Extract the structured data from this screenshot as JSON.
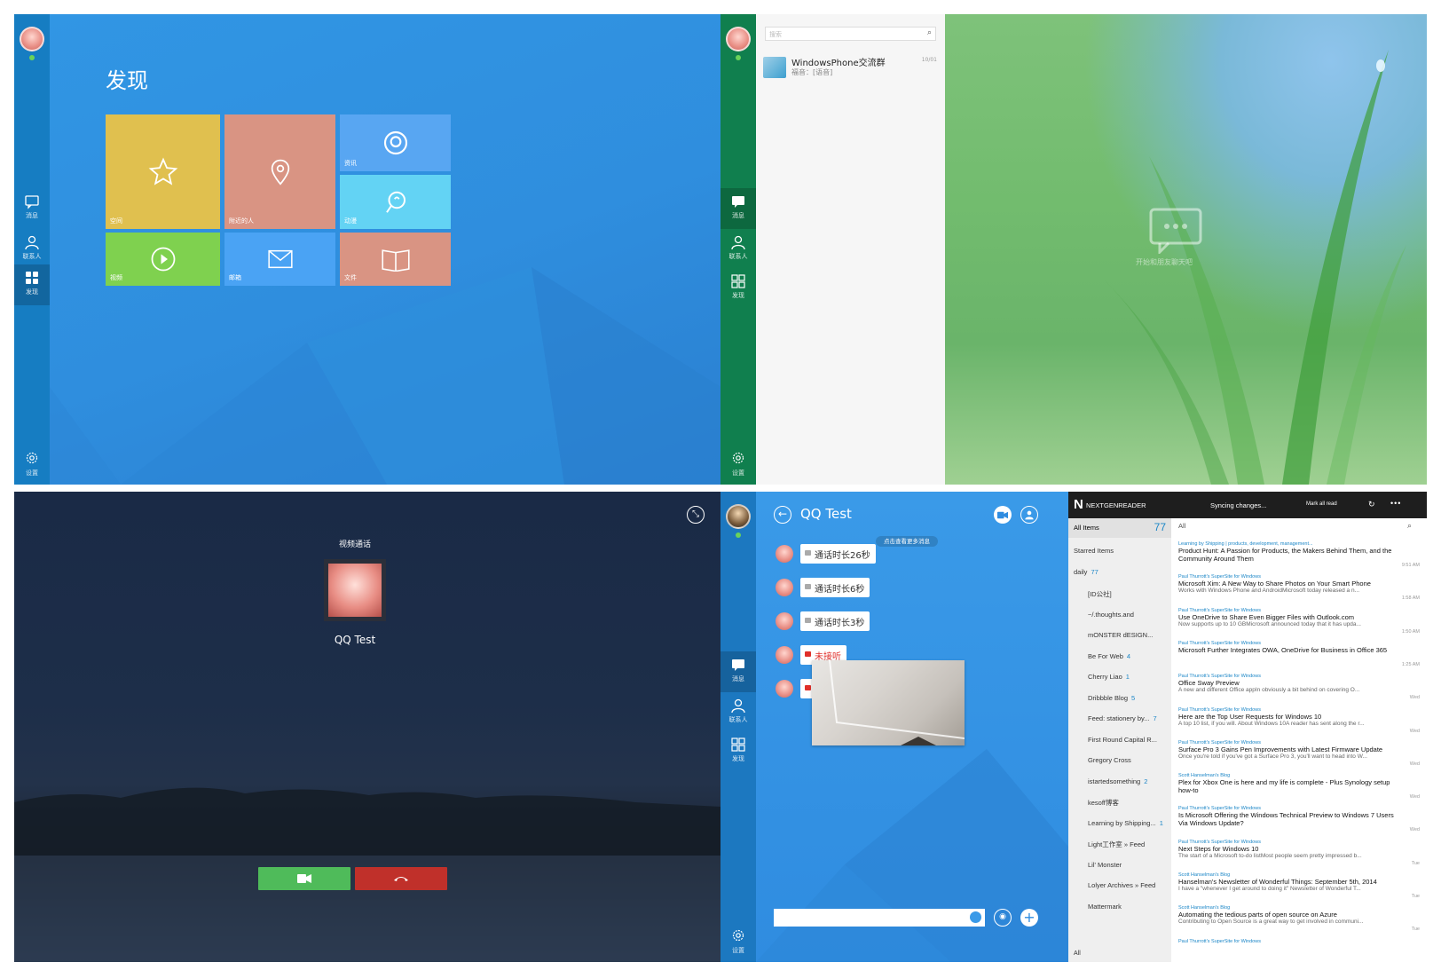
{
  "discover": {
    "title": "发现",
    "tiles": [
      {
        "label": "空间",
        "icon": "star-icon",
        "color": "#e0c04f"
      },
      {
        "label": "附近的人",
        "icon": "location-pin-icon",
        "color": "#d99483"
      },
      {
        "label": "资讯",
        "icon": "qq-logo-icon",
        "color": "#58a6f2"
      },
      {
        "label": "动漫",
        "icon": "comic-icon",
        "color": "#63d3f4"
      },
      {
        "label": "视频",
        "icon": "play-icon",
        "color": "#7fd14f"
      },
      {
        "label": "邮箱",
        "icon": "mail-icon",
        "color": "#4aa3f4"
      },
      {
        "label": "文件",
        "icon": "book-icon",
        "color": "#d99483"
      }
    ],
    "nav": [
      "消息",
      "联系人",
      "发现"
    ],
    "settings_label": "设置"
  },
  "messages": {
    "search_placeholder": "搜索",
    "conversation": {
      "name": "WindowsPhone交流群",
      "snippet": "福音：[语音]",
      "time": "10/01"
    },
    "nav": [
      "消息",
      "联系人",
      "发现"
    ],
    "settings_label": "设置",
    "empty_text": "开始和朋友聊天吧"
  },
  "video_call": {
    "status": "视频通话",
    "name": "QQ Test",
    "accent_accept": "#4fbb5a",
    "accent_decline": "#c0302a"
  },
  "chat": {
    "title": "QQ Test",
    "load_more": "点击查看更多消息",
    "messages": [
      {
        "text": "通话时长26秒",
        "missed": false
      },
      {
        "text": "通话时长6秒",
        "missed": false
      },
      {
        "text": "通话时长3秒",
        "missed": false
      },
      {
        "text": "未接听",
        "missed": true
      },
      {
        "text": "",
        "missed": false
      }
    ],
    "nav": [
      "消息",
      "联系人",
      "发现"
    ],
    "settings_label": "设置"
  },
  "reader": {
    "logo": "NEXTGENREADER",
    "sync": "Syncing changes...",
    "mark_all": "Mark all read",
    "all_items": "All Items",
    "all_count": "77",
    "starred": "Starred Items",
    "filter": "All",
    "folder": "daily",
    "folder_count": "77",
    "feeds": [
      {
        "name": "[ID公社]",
        "count": ""
      },
      {
        "name": "~/.thoughts.and",
        "count": ""
      },
      {
        "name": "mONSTER dESIGN...",
        "count": ""
      },
      {
        "name": "Be For Web",
        "count": "4"
      },
      {
        "name": "Cherry Liao",
        "count": "1"
      },
      {
        "name": "Dribbble Blog",
        "count": "5"
      },
      {
        "name": "Feed: stationery by...",
        "count": "7"
      },
      {
        "name": "First Round Capital R...",
        "count": ""
      },
      {
        "name": "Gregory Cross",
        "count": ""
      },
      {
        "name": "istartedsomething",
        "count": "2"
      },
      {
        "name": "kesoff博客",
        "count": ""
      },
      {
        "name": "Learning by Shipping...",
        "count": "1"
      },
      {
        "name": "Light工作室 » Feed",
        "count": ""
      },
      {
        "name": "Lil' Monster",
        "count": ""
      },
      {
        "name": "Lolyer Archives » Feed",
        "count": ""
      },
      {
        "name": "Mattermark",
        "count": ""
      }
    ],
    "bottom_filter": "All",
    "articles": [
      {
        "src": "Learning by Shipping | products, development, management...",
        "title": "Product Hunt: A Passion for Products, the Makers Behind Them, and the Community Around Them",
        "snippet": "",
        "time": "9:51 AM"
      },
      {
        "src": "Paul Thurrott's SuperSite for Windows",
        "title": "Microsoft Xim: A New Way to Share Photos on Your Smart Phone",
        "snippet": "Works with Windows Phone and AndroidMicrosoft today released a n...",
        "time": "1:58 AM"
      },
      {
        "src": "Paul Thurrott's SuperSite for Windows",
        "title": "Use OneDrive to Share Even Bigger Files with Outlook.com",
        "snippet": "Now supports up to 10 GBMicrosoft announced today that it has upda...",
        "time": "1:50 AM"
      },
      {
        "src": "Paul Thurrott's SuperSite for Windows",
        "title": "Microsoft Further Integrates OWA, OneDrive for Business in Office 365",
        "snippet": "",
        "time": "1:25 AM"
      },
      {
        "src": "Paul Thurrott's SuperSite for Windows",
        "title": "Office Sway Preview",
        "snippet": "A new and different Office appIn obviously a bit behind on covering O...",
        "time": "Wed"
      },
      {
        "src": "Paul Thurrott's SuperSite for Windows",
        "title": "Here are the Top User Requests for Windows 10",
        "snippet": "A top 10 list, if you will. About Windows 10A reader has sent along the r...",
        "time": "Wed"
      },
      {
        "src": "Paul Thurrott's SuperSite for Windows",
        "title": "Surface Pro 3 Gains Pen Improvements with Latest Firmware Update",
        "snippet": "Once you're told if you've got a Surface Pro 3, you'll want to head into W...",
        "time": "Wed"
      },
      {
        "src": "Scott Hanselman's Blog",
        "title": "Plex for Xbox One is here and my life is complete - Plus Synology setup how-to",
        "snippet": "",
        "time": "Wed"
      },
      {
        "src": "Paul Thurrott's SuperSite for Windows",
        "title": "Is Microsoft Offering the Windows Technical Preview to Windows 7 Users Via Windows Update?",
        "snippet": "",
        "time": "Wed"
      },
      {
        "src": "Paul Thurrott's SuperSite for Windows",
        "title": "Next Steps for Windows 10",
        "snippet": "The start of a Microsoft to-do listMost people seem pretty impressed b...",
        "time": "Tue"
      },
      {
        "src": "Scott Hanselman's Blog",
        "title": "Hanselman's Newsletter of Wonderful Things: September 5th, 2014",
        "snippet": "I have a \"whenever I get around to doing it\" Newsletter of Wonderful T...",
        "time": "Tue"
      },
      {
        "src": "Scott Hanselman's Blog",
        "title": "Automating the tedious parts of open source on Azure",
        "snippet": "Contributing to Open Source is a great way to get involved in communi...",
        "time": "Tue"
      },
      {
        "src": "Paul Thurrott's SuperSite for Windows",
        "title": "",
        "snippet": "",
        "time": ""
      }
    ]
  }
}
